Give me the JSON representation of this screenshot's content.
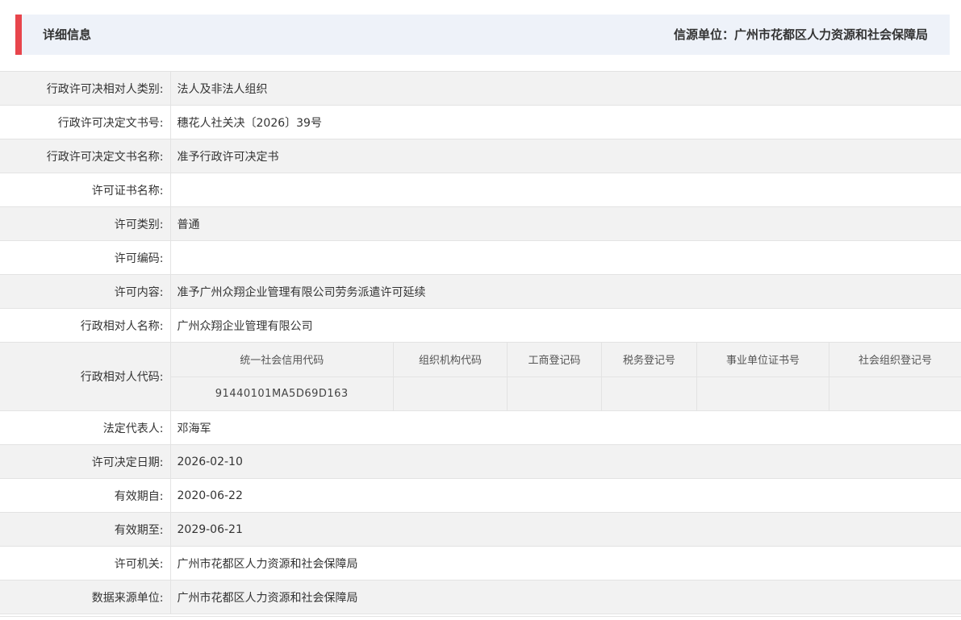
{
  "header": {
    "title": "详细信息",
    "source_unit": "信源单位：广州市花都区人力资源和社会保障局",
    "accent_color": "#e8454c",
    "background_color": "#eef2f9"
  },
  "rows_top": [
    {
      "label": "行政许可决相对人类别:",
      "value": "法人及非法人组织"
    },
    {
      "label": "行政许可决定文书号:",
      "value": "穗花人社关决〔2026〕39号"
    },
    {
      "label": "行政许可决定文书名称:",
      "value": "准予行政许可决定书"
    },
    {
      "label": "许可证书名称:",
      "value": ""
    },
    {
      "label": "许可类别:",
      "value": "普通"
    },
    {
      "label": "许可编码:",
      "value": ""
    },
    {
      "label": "许可内容:",
      "value": "准予广州众翔企业管理有限公司劳务派遣许可延续"
    },
    {
      "label": "行政相对人名称:",
      "value": "广州众翔企业管理有限公司"
    }
  ],
  "codes": {
    "label": "行政相对人代码:",
    "headers": [
      "统一社会信用代码",
      "组织机构代码",
      "工商登记码",
      "税务登记号",
      "事业单位证书号",
      "社会组织登记号"
    ],
    "values": [
      "91440101MA5D69D163",
      "",
      "",
      "",
      "",
      ""
    ]
  },
  "rows_bottom": [
    {
      "label": "法定代表人:",
      "value": "邓海军"
    },
    {
      "label": "许可决定日期:",
      "value": "2026-02-10"
    },
    {
      "label": "有效期自:",
      "value": "2020-06-22"
    },
    {
      "label": "有效期至:",
      "value": "2029-06-21"
    },
    {
      "label": "许可机关:",
      "value": "广州市花都区人力资源和社会保障局"
    },
    {
      "label": "数据来源单位:",
      "value": "广州市花都区人力资源和社会保障局"
    }
  ]
}
